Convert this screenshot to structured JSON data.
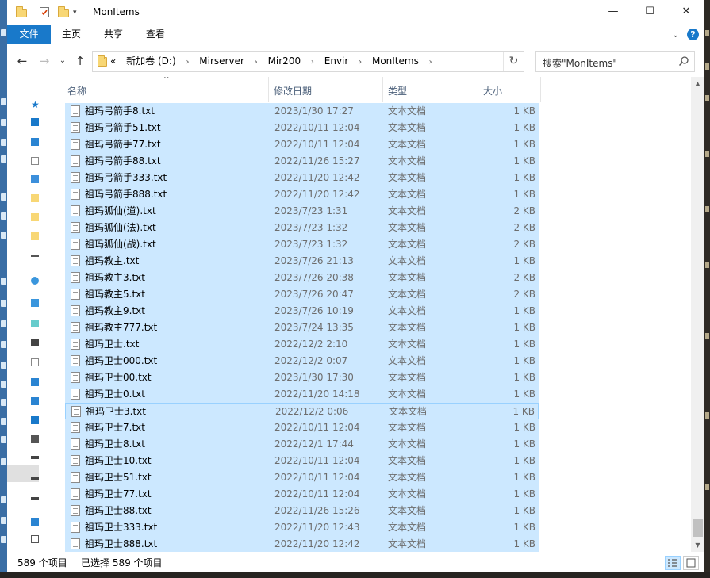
{
  "window": {
    "title": "MonItems",
    "minimize": "—",
    "maximize": "☐",
    "close": "✕"
  },
  "ribbon": {
    "file": "文件",
    "tabs": [
      "主页",
      "共享",
      "查看"
    ]
  },
  "nav": {
    "back": "←",
    "forward": "→",
    "recent": "⌄",
    "up": "↑",
    "overflow": "«",
    "crumbs": [
      "新加卷 (D:)",
      "Mirserver",
      "Mir200",
      "Envir",
      "MonItems"
    ],
    "separator": "›",
    "refresh": "↻",
    "search_placeholder": "搜索\"MonItems\""
  },
  "columns": {
    "name": "名称",
    "date": "修改日期",
    "type": "类型",
    "size": "大小"
  },
  "files": [
    {
      "name": "祖玛弓箭手8.txt",
      "date": "2023/1/30 17:27",
      "type": "文本文档",
      "size": "1 KB"
    },
    {
      "name": "祖玛弓箭手51.txt",
      "date": "2022/10/11 12:04",
      "type": "文本文档",
      "size": "1 KB"
    },
    {
      "name": "祖玛弓箭手77.txt",
      "date": "2022/10/11 12:04",
      "type": "文本文档",
      "size": "1 KB"
    },
    {
      "name": "祖玛弓箭手88.txt",
      "date": "2022/11/26 15:27",
      "type": "文本文档",
      "size": "1 KB"
    },
    {
      "name": "祖玛弓箭手333.txt",
      "date": "2022/11/20 12:42",
      "type": "文本文档",
      "size": "1 KB"
    },
    {
      "name": "祖玛弓箭手888.txt",
      "date": "2022/11/20 12:42",
      "type": "文本文档",
      "size": "1 KB"
    },
    {
      "name": "祖玛狐仙(道).txt",
      "date": "2023/7/23 1:31",
      "type": "文本文档",
      "size": "2 KB"
    },
    {
      "name": "祖玛狐仙(法).txt",
      "date": "2023/7/23 1:32",
      "type": "文本文档",
      "size": "2 KB"
    },
    {
      "name": "祖玛狐仙(战).txt",
      "date": "2023/7/23 1:32",
      "type": "文本文档",
      "size": "2 KB"
    },
    {
      "name": "祖玛教主.txt",
      "date": "2023/7/26 21:13",
      "type": "文本文档",
      "size": "1 KB"
    },
    {
      "name": "祖玛教主3.txt",
      "date": "2023/7/26 20:38",
      "type": "文本文档",
      "size": "2 KB"
    },
    {
      "name": "祖玛教主5.txt",
      "date": "2023/7/26 20:47",
      "type": "文本文档",
      "size": "2 KB"
    },
    {
      "name": "祖玛教主9.txt",
      "date": "2023/7/26 10:19",
      "type": "文本文档",
      "size": "1 KB"
    },
    {
      "name": "祖玛教主777.txt",
      "date": "2023/7/24 13:35",
      "type": "文本文档",
      "size": "1 KB"
    },
    {
      "name": "祖玛卫士.txt",
      "date": "2022/12/2 2:10",
      "type": "文本文档",
      "size": "1 KB"
    },
    {
      "name": "祖玛卫士000.txt",
      "date": "2022/12/2 0:07",
      "type": "文本文档",
      "size": "1 KB"
    },
    {
      "name": "祖玛卫士00.txt",
      "date": "2023/1/30 17:30",
      "type": "文本文档",
      "size": "1 KB"
    },
    {
      "name": "祖玛卫士0.txt",
      "date": "2022/11/20 14:18",
      "type": "文本文档",
      "size": "1 KB"
    },
    {
      "name": "祖玛卫士3.txt",
      "date": "2022/12/2 0:06",
      "type": "文本文档",
      "size": "1 KB"
    },
    {
      "name": "祖玛卫士7.txt",
      "date": "2022/10/11 12:04",
      "type": "文本文档",
      "size": "1 KB"
    },
    {
      "name": "祖玛卫士8.txt",
      "date": "2022/12/1 17:44",
      "type": "文本文档",
      "size": "1 KB"
    },
    {
      "name": "祖玛卫士10.txt",
      "date": "2022/10/11 12:04",
      "type": "文本文档",
      "size": "1 KB"
    },
    {
      "name": "祖玛卫士51.txt",
      "date": "2022/10/11 12:04",
      "type": "文本文档",
      "size": "1 KB"
    },
    {
      "name": "祖玛卫士77.txt",
      "date": "2022/10/11 12:04",
      "type": "文本文档",
      "size": "1 KB"
    },
    {
      "name": "祖玛卫士88.txt",
      "date": "2022/11/26 15:26",
      "type": "文本文档",
      "size": "1 KB"
    },
    {
      "name": "祖玛卫士333.txt",
      "date": "2022/11/20 12:43",
      "type": "文本文档",
      "size": "1 KB"
    },
    {
      "name": "祖玛卫士888.txt",
      "date": "2022/11/20 12:42",
      "type": "文本文档",
      "size": "1 KB"
    }
  ],
  "focused_row": "祖玛卫士3.txt",
  "status": {
    "count": "589 个项目",
    "selected": "已选择 589 个项目"
  },
  "colors": {
    "selection": "#cce8ff",
    "selection_border": "#99d1ff",
    "accent": "#1979ca"
  }
}
